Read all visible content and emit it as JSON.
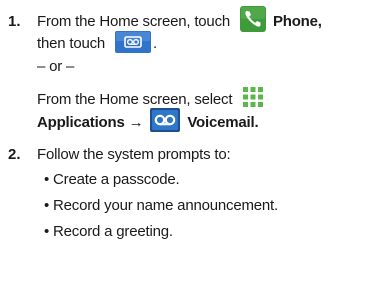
{
  "step1": {
    "number": "1.",
    "line1_prefix": "From the Home screen, touch",
    "line1_bold": "Phone",
    "line1_suffix": ",",
    "line2_prefix": "then touch",
    "line2_suffix": ".",
    "or": "– or –",
    "alt_line1": "From the Home screen, select",
    "alt_apps": "Applications",
    "alt_arrow": "→",
    "alt_voicemail": "Voicemail",
    "alt_suffix": "."
  },
  "step2": {
    "number": "2.",
    "intro": "Follow the system prompts to:",
    "bullets": [
      "• Create a passcode.",
      "• Record your name announcement.",
      "• Record a greeting."
    ]
  },
  "icons": {
    "phone": "phone-icon",
    "voicemail_button": "voicemail-button-icon",
    "applications": "applications-icon",
    "voicemail_app": "voicemail-app-icon"
  },
  "colors": {
    "phone_green": "#3f9a3a",
    "button_blue": "#2f74c9",
    "apps_green": "#5ab84a"
  }
}
